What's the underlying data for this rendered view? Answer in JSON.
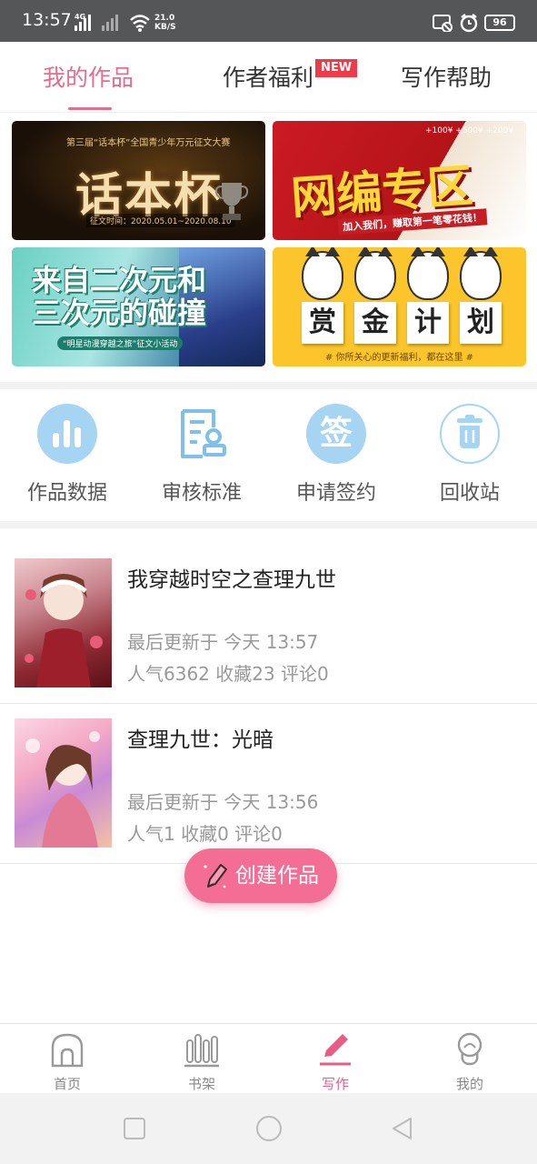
{
  "status_bar": {
    "time": "13:57",
    "network": "4G",
    "speed_value": "21.0",
    "speed_unit": "KB/S",
    "battery": "96"
  },
  "tabs": {
    "my_works": "我的作品",
    "author_benefits": "作者福利",
    "new_badge": "NEW",
    "writing_help": "写作帮助",
    "active": "my_works",
    "accent_color": "#e56c8a"
  },
  "banners": [
    {
      "title": "话本杯",
      "top_text": "第三届“话本杯”全国青少年万元征文大赛",
      "date_text": "征文时间：2020.05.01~2020.08.10"
    },
    {
      "title": "网编专区",
      "sub": "加入我们，赚取第一笔零花钱！",
      "coins": "+100¥  +500¥  +200¥"
    },
    {
      "title_line1": "来自二次元和",
      "title_line2": "三次元的碰撞",
      "sub": "“明星动漫穿越之旅”征文小活动"
    },
    {
      "chars": [
        "赏",
        "金",
        "计",
        "划"
      ],
      "sub": "# 你所关心的更新福利，都在这里 #"
    }
  ],
  "quick_actions": [
    {
      "label": "作品数据",
      "icon": "bar-chart-icon"
    },
    {
      "label": "审核标准",
      "icon": "document-stamp-icon"
    },
    {
      "label": "申请签约",
      "icon": "sign-icon",
      "glyph": "签"
    },
    {
      "label": "回收站",
      "icon": "trash-icon"
    }
  ],
  "books": [
    {
      "title": "我穿越时空之查理九世",
      "updated": "最后更新于 今天 13:57",
      "stats": "人气6362 收藏23 评论0"
    },
    {
      "title": "查理九世：光暗",
      "updated": "最后更新于 今天 13:56",
      "stats": "人气1 收藏0 评论0"
    }
  ],
  "fab": {
    "label": "创建作品",
    "color": "#f46d95"
  },
  "bottom_nav": [
    {
      "label": "首页",
      "icon": "home-icon"
    },
    {
      "label": "书架",
      "icon": "bookshelf-icon"
    },
    {
      "label": "写作",
      "icon": "pencil-icon",
      "active": true
    },
    {
      "label": "我的",
      "icon": "profile-icon"
    }
  ]
}
